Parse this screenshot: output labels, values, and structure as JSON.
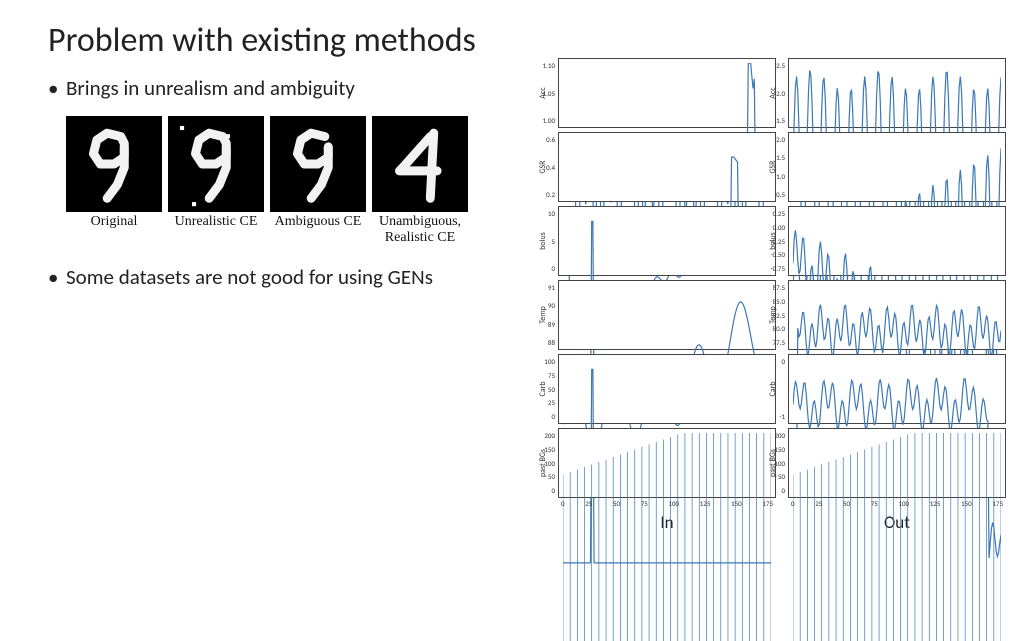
{
  "title": "Problem with existing methods",
  "bullets": [
    "Brings in unrealism and ambiguity",
    "Some datasets are not good for using GENs"
  ],
  "digits": [
    {
      "caption": "Original",
      "glyph": "9",
      "noise": []
    },
    {
      "caption": "Unrealistic CE",
      "glyph": "9",
      "noise": [
        [
          12,
          10
        ],
        [
          58,
          18
        ],
        [
          24,
          86
        ]
      ]
    },
    {
      "caption": "Ambiguous CE",
      "glyph": "9a",
      "noise": []
    },
    {
      "caption": "Unambiguous, Realistic CE",
      "glyph": "4",
      "noise": []
    }
  ],
  "columns": [
    {
      "label": "In",
      "xticks": [
        0,
        25,
        50,
        75,
        100,
        125,
        150,
        175
      ]
    },
    {
      "label": "Out",
      "xticks": [
        0,
        25,
        50,
        75,
        100,
        125,
        150,
        175
      ]
    }
  ],
  "signals": [
    {
      "name": "Acc",
      "yticks_in": [
        "1.10",
        "1.05",
        "1.00"
      ],
      "yticks_out": [
        "2.5",
        "2.0",
        "1.5"
      ]
    },
    {
      "name": "GSR",
      "yticks_in": [
        "0.6",
        "0.4",
        "0.2"
      ],
      "yticks_out": [
        "2.0",
        "1.5",
        "1.0",
        "0.5"
      ]
    },
    {
      "name": "bolus",
      "yticks_in": [
        "10",
        "5",
        "0"
      ],
      "yticks_out": [
        "0.25",
        "0.00",
        "-0.25",
        "-0.50",
        "-0.75"
      ]
    },
    {
      "name": "Temp",
      "yticks_in": [
        "91",
        "90",
        "89",
        "88"
      ],
      "yticks_out": [
        "87.5",
        "85.0",
        "82.5",
        "80.0",
        "77.5"
      ]
    },
    {
      "name": "Carb",
      "yticks_in": [
        "100",
        "75",
        "50",
        "25",
        "0"
      ],
      "yticks_out": [
        "0",
        "-1"
      ]
    },
    {
      "name": "past BGs",
      "yticks_in": [
        "200",
        "150",
        "100",
        "50",
        "0"
      ],
      "yticks_out": [
        "200",
        "150",
        "100",
        "50",
        "0"
      ]
    }
  ],
  "chart_data": [
    {
      "type": "line",
      "title": "",
      "ylabel": "Acc",
      "column": "In",
      "xlim": [
        0,
        175
      ],
      "ylim": [
        1.0,
        1.1
      ],
      "n_points": 175,
      "shape": "noisy_flat_spike_at_160"
    },
    {
      "type": "line",
      "title": "",
      "ylabel": "GSR",
      "column": "In",
      "xlim": [
        0,
        175
      ],
      "ylim": [
        0.1,
        0.7
      ],
      "n_points": 175,
      "shape": "slow_rise_with_late_peak"
    },
    {
      "type": "line",
      "title": "",
      "ylabel": "bolus",
      "column": "In",
      "xlim": [
        0,
        175
      ],
      "ylim": [
        0,
        12
      ],
      "n_points": 175,
      "shape": "single_spike_at_25"
    },
    {
      "type": "line",
      "title": "",
      "ylabel": "Temp",
      "column": "In",
      "xlim": [
        0,
        175
      ],
      "ylim": [
        87.5,
        91.5
      ],
      "n_points": 175,
      "shape": "dip_then_wander_up"
    },
    {
      "type": "line",
      "title": "",
      "ylabel": "Carb",
      "column": "In",
      "xlim": [
        0,
        175
      ],
      "ylim": [
        0,
        100
      ],
      "n_points": 175,
      "shape": "single_spike_at_25"
    },
    {
      "type": "line",
      "title": "",
      "ylabel": "past BGs",
      "column": "In",
      "xlim": [
        0,
        175
      ],
      "ylim": [
        0,
        220
      ],
      "n_points": 175,
      "shape": "periodic_spikes_rising"
    },
    {
      "type": "line",
      "title": "",
      "ylabel": "Acc",
      "column": "Out",
      "xlim": [
        0,
        175
      ],
      "ylim": [
        1.2,
        2.6
      ],
      "n_points": 175,
      "shape": "large_oscillation"
    },
    {
      "type": "line",
      "title": "",
      "ylabel": "GSR",
      "column": "Out",
      "xlim": [
        0,
        175
      ],
      "ylim": [
        0.3,
        2.2
      ],
      "n_points": 175,
      "shape": "growing_oscillation"
    },
    {
      "type": "line",
      "title": "",
      "ylabel": "bolus",
      "column": "Out",
      "xlim": [
        0,
        175
      ],
      "ylim": [
        -0.8,
        0.3
      ],
      "n_points": 175,
      "shape": "noisy_declining"
    },
    {
      "type": "line",
      "title": "",
      "ylabel": "Temp",
      "column": "Out",
      "xlim": [
        0,
        175
      ],
      "ylim": [
        77,
        88
      ],
      "n_points": 175,
      "shape": "jump_then_noisy_flat"
    },
    {
      "type": "line",
      "title": "",
      "ylabel": "Carb",
      "column": "Out",
      "xlim": [
        0,
        175
      ],
      "ylim": [
        -1.5,
        0.5
      ],
      "n_points": 175,
      "shape": "noisy_flat_late_drop"
    },
    {
      "type": "line",
      "title": "",
      "ylabel": "past BGs",
      "column": "Out",
      "xlim": [
        0,
        175
      ],
      "ylim": [
        0,
        220
      ],
      "n_points": 175,
      "shape": "periodic_spikes_rising"
    }
  ]
}
